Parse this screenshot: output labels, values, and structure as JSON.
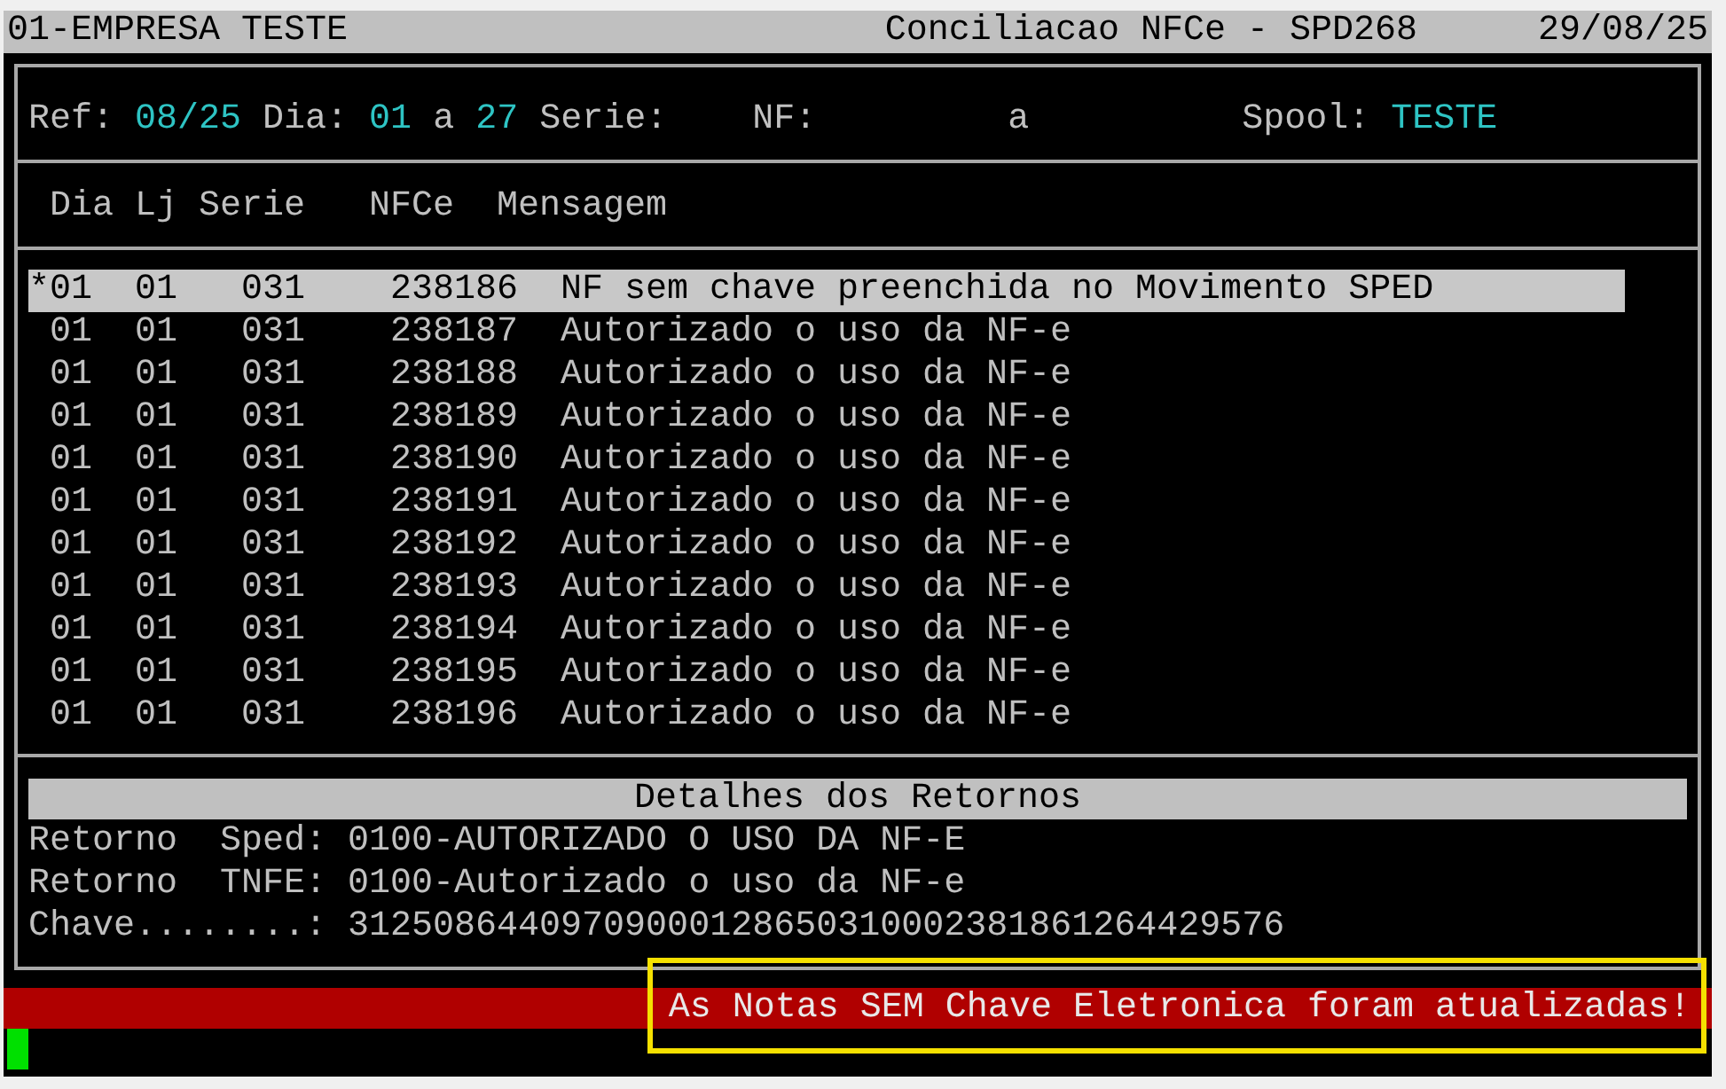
{
  "title_bar": {
    "company": "01-EMPRESA TESTE",
    "screen": "Conciliacao NFCe - SPD268",
    "date": "29/08/25"
  },
  "filter": {
    "ref_label": "Ref:",
    "ref": "08/25",
    "dia_label": "Dia:",
    "dia_from": "01",
    "dia_sep": "a",
    "dia_to": "27",
    "serie_label": "Serie:",
    "nf_label": "NF:",
    "nf_sep": "a",
    "spool_label": "Spool:",
    "spool": "TESTE"
  },
  "table": {
    "columns": [
      "Dia",
      "Lj",
      "Serie",
      "NFCe",
      "Mensagem"
    ],
    "rows": [
      {
        "marker": "*",
        "dia": "01",
        "lj": "01",
        "serie": "031",
        "nfce": "238186",
        "mensagem": "NF sem chave preenchida no Movimento SPED",
        "selected": true
      },
      {
        "dia": "01",
        "lj": "01",
        "serie": "031",
        "nfce": "238187",
        "mensagem": "Autorizado o uso da NF-e",
        "selected": false
      },
      {
        "dia": "01",
        "lj": "01",
        "serie": "031",
        "nfce": "238188",
        "mensagem": "Autorizado o uso da NF-e",
        "selected": false
      },
      {
        "dia": "01",
        "lj": "01",
        "serie": "031",
        "nfce": "238189",
        "mensagem": "Autorizado o uso da NF-e",
        "selected": false
      },
      {
        "dia": "01",
        "lj": "01",
        "serie": "031",
        "nfce": "238190",
        "mensagem": "Autorizado o uso da NF-e",
        "selected": false
      },
      {
        "dia": "01",
        "lj": "01",
        "serie": "031",
        "nfce": "238191",
        "mensagem": "Autorizado o uso da NF-e",
        "selected": false
      },
      {
        "dia": "01",
        "lj": "01",
        "serie": "031",
        "nfce": "238192",
        "mensagem": "Autorizado o uso da NF-e",
        "selected": false
      },
      {
        "dia": "01",
        "lj": "01",
        "serie": "031",
        "nfce": "238193",
        "mensagem": "Autorizado o uso da NF-e",
        "selected": false
      },
      {
        "dia": "01",
        "lj": "01",
        "serie": "031",
        "nfce": "238194",
        "mensagem": "Autorizado o uso da NF-e",
        "selected": false
      },
      {
        "dia": "01",
        "lj": "01",
        "serie": "031",
        "nfce": "238195",
        "mensagem": "Autorizado o uso da NF-e",
        "selected": false
      },
      {
        "dia": "01",
        "lj": "01",
        "serie": "031",
        "nfce": "238196",
        "mensagem": "Autorizado o uso da NF-e",
        "selected": false
      }
    ]
  },
  "details": {
    "title": "Detalhes dos Retornos",
    "lines": [
      {
        "label": "Retorno  Sped:",
        "value": "0100-AUTORIZADO O USO DA NF-E"
      },
      {
        "label": "Retorno  TNFE:",
        "value": "0100-Autorizado o uso da NF-e"
      },
      {
        "label": "Chave........:",
        "value": "31250864409709000128650310002381861264429576"
      }
    ]
  },
  "status_message": {
    "text": "As Notas SEM Chave Eletronica foram atualizadas!",
    "highlighted": true
  }
}
